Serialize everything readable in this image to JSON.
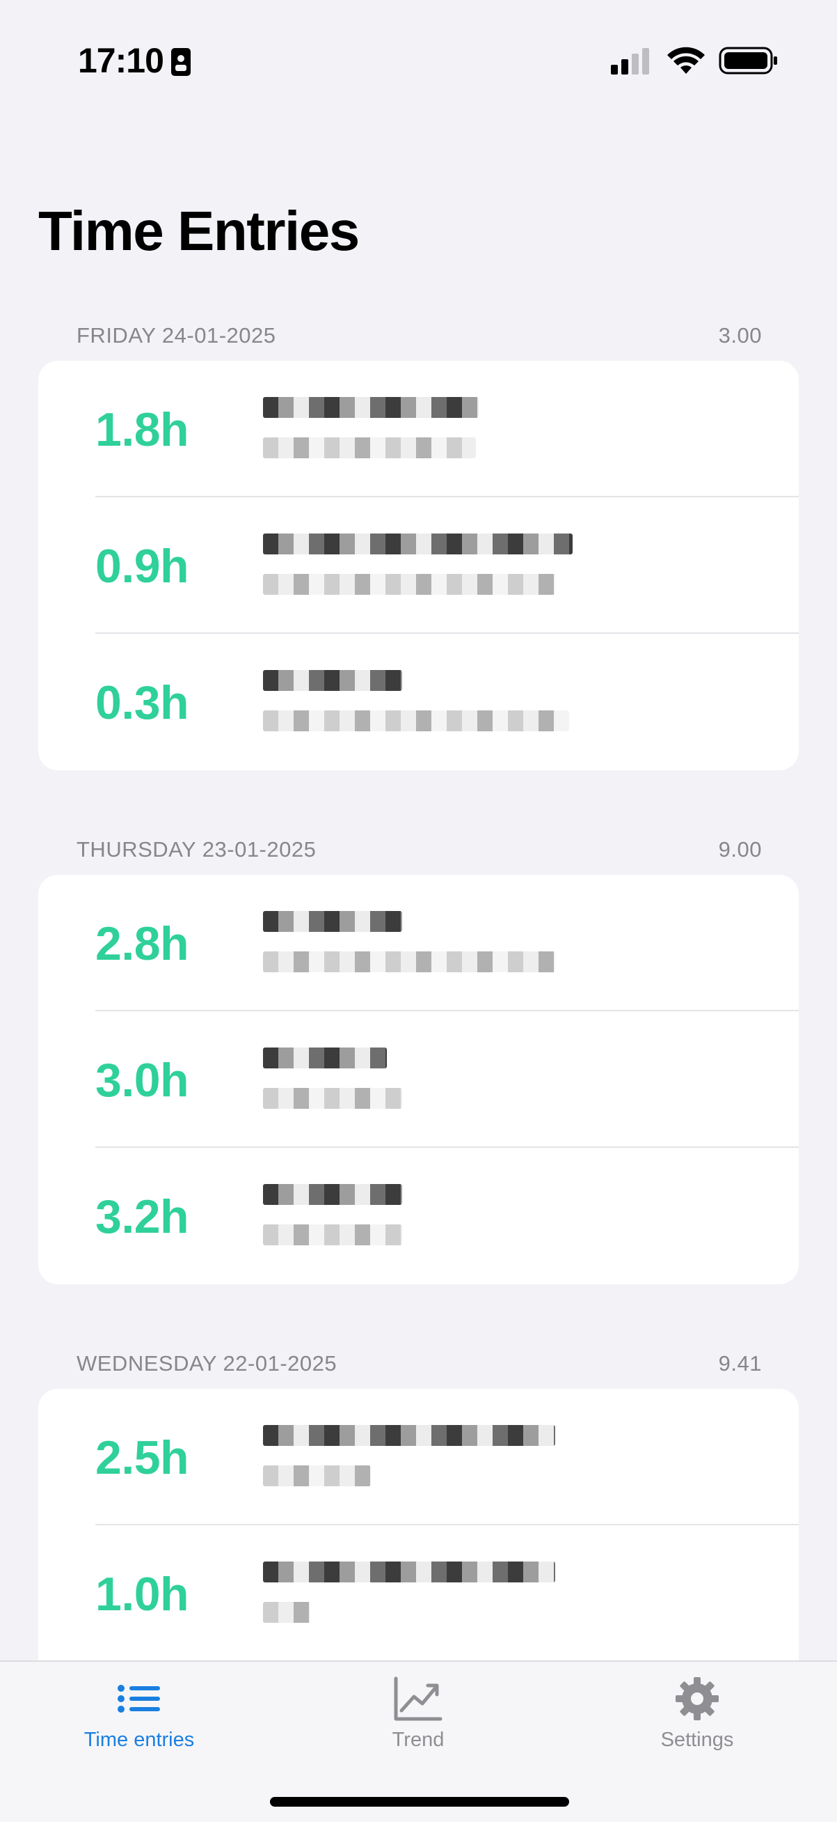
{
  "status_bar": {
    "time": "17:10"
  },
  "page": {
    "title": "Time Entries"
  },
  "sections": [
    {
      "date": "FRIDAY 24-01-2025",
      "total": "3.00",
      "entries": [
        {
          "hours": "1.8h"
        },
        {
          "hours": "0.9h"
        },
        {
          "hours": "0.3h"
        }
      ]
    },
    {
      "date": "THURSDAY 23-01-2025",
      "total": "9.00",
      "entries": [
        {
          "hours": "2.8h"
        },
        {
          "hours": "3.0h"
        },
        {
          "hours": "3.2h"
        }
      ]
    },
    {
      "date": "WEDNESDAY 22-01-2025",
      "total": "9.41",
      "entries": [
        {
          "hours": "2.5h"
        },
        {
          "hours": "1.0h"
        }
      ]
    }
  ],
  "tabs": [
    {
      "label": "Time entries",
      "icon": "list-icon",
      "active": true
    },
    {
      "label": "Trend",
      "icon": "chart-line-icon",
      "active": false
    },
    {
      "label": "Settings",
      "icon": "gear-icon",
      "active": false
    }
  ],
  "colors": {
    "accent": "#1a7fe0",
    "hours": "#2fd09a",
    "background": "#f2f2f7"
  }
}
